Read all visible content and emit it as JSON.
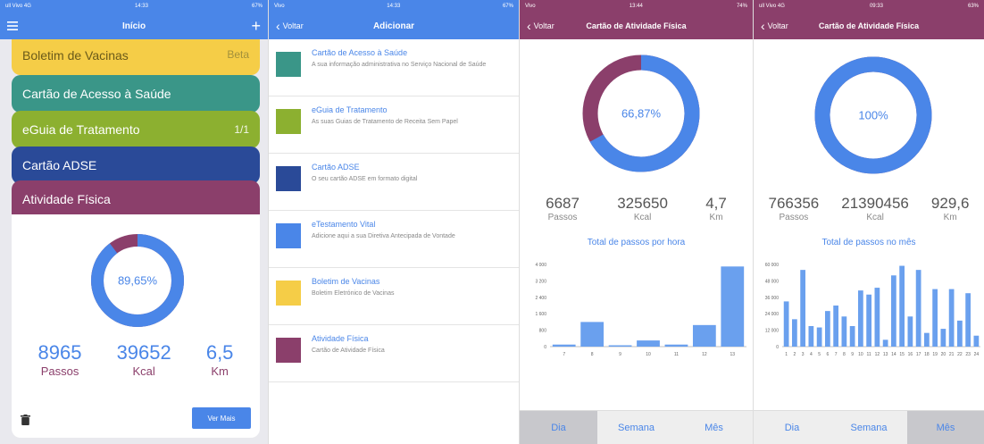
{
  "colors": {
    "blue": "#4a86e8",
    "purple": "#8b3f6b",
    "yellow": "#f5cd47",
    "teal": "#3a9688",
    "olive": "#8cb030",
    "navy": "#2a4a98"
  },
  "screen1": {
    "status": {
      "left": "ull Vivo 4G",
      "center": "14:33",
      "right": "67%"
    },
    "nav": {
      "title": "Início",
      "add": "+"
    },
    "cards": [
      {
        "label": "Boletim de Vacinas",
        "count": "Beta"
      },
      {
        "label": "Cartão de Acesso à Saúde",
        "count": ""
      },
      {
        "label": "eGuia de Tratamento",
        "count": "1/1"
      },
      {
        "label": "Cartão ADSE",
        "count": ""
      },
      {
        "label": "Atividade Física",
        "count": ""
      }
    ],
    "ring": {
      "label": "89,65%",
      "fraction": 0.8965
    },
    "stats": [
      {
        "value": "8965",
        "label": "Passos"
      },
      {
        "value": "39652",
        "label": "Kcal"
      },
      {
        "value": "6,5",
        "label": "Km"
      }
    ],
    "more_button": "Ver Mais"
  },
  "screen2": {
    "status": {
      "left": "Vivo",
      "center": "14:33",
      "right": "67%"
    },
    "nav": {
      "back": "Voltar",
      "title": "Adicionar"
    },
    "items": [
      {
        "title": "Cartão de Acesso à Saúde",
        "subtitle": "A sua informação administrativa no Serviço Nacional de Saúde",
        "color": "#3a9688"
      },
      {
        "title": "eGuia de Tratamento",
        "subtitle": "As suas Guias de Tratamento de Receita Sem Papel",
        "color": "#8cb030"
      },
      {
        "title": "Cartão ADSE",
        "subtitle": "O seu cartão ADSE em formato digital",
        "color": "#2a4a98"
      },
      {
        "title": "eTestamento Vital",
        "subtitle": "Adicione aqui a sua Diretiva Antecipada de Vontade",
        "color": "#4a86e8"
      },
      {
        "title": "Boletim de Vacinas",
        "subtitle": "Boletim Eletrónico de Vacinas",
        "color": "#f5cd47"
      },
      {
        "title": "Atividade Física",
        "subtitle": "Cartão de Atividade Física",
        "color": "#8b3f6b"
      }
    ]
  },
  "screen3": {
    "status": {
      "left": "Vivo",
      "center": "13:44",
      "right": "74%"
    },
    "nav": {
      "back": "Voltar",
      "title": "Cartão de Atividade Física"
    },
    "ring": {
      "label": "66,87%",
      "fraction": 0.6687
    },
    "stats": [
      {
        "value": "6687",
        "label": "Passos"
      },
      {
        "value": "325650",
        "label": "Kcal"
      },
      {
        "value": "4,7",
        "label": "Km"
      }
    ],
    "chart_title": "Total de passos por hora",
    "tabs": [
      "Dia",
      "Semana",
      "Mês"
    ],
    "active_tab": 0,
    "chart_data": {
      "type": "bar",
      "title": "Total de passos por hora",
      "categories": [
        "7",
        "8",
        "9",
        "10",
        "11",
        "12",
        "13"
      ],
      "values": [
        100,
        1200,
        50,
        300,
        100,
        1050,
        3900
      ],
      "ylim": [
        0,
        4000
      ],
      "yticks": [
        "0",
        "800",
        "1 600",
        "2 400",
        "3 200",
        "4 000"
      ]
    }
  },
  "screen4": {
    "status": {
      "left": "ull Vivo 4G",
      "center": "09:33",
      "right": "63%"
    },
    "nav": {
      "back": "Voltar",
      "title": "Cartão de Atividade Física"
    },
    "ring": {
      "label": "100%",
      "fraction": 1.0
    },
    "stats": [
      {
        "value": "766356",
        "label": "Passos"
      },
      {
        "value": "21390456",
        "label": "Kcal"
      },
      {
        "value": "929,6",
        "label": "Km"
      }
    ],
    "chart_title": "Total de passos no mês",
    "tabs": [
      "Dia",
      "Semana",
      "Mês"
    ],
    "active_tab": 2,
    "chart_data": {
      "type": "bar",
      "title": "Total de passos no mês",
      "categories": [
        "1",
        "2",
        "3",
        "4",
        "5",
        "6",
        "7",
        "8",
        "9",
        "10",
        "11",
        "12",
        "13",
        "14",
        "15",
        "16",
        "17",
        "18",
        "19",
        "20",
        "21",
        "22",
        "23",
        "24"
      ],
      "values": [
        33000,
        20000,
        56000,
        15000,
        14000,
        26000,
        30000,
        22000,
        15000,
        41000,
        38000,
        43000,
        5000,
        52000,
        59000,
        22000,
        56000,
        10000,
        42000,
        13000,
        42000,
        19000,
        39000,
        8000
      ],
      "ylim": [
        0,
        60000
      ],
      "yticks": [
        "0",
        "12 000",
        "24 000",
        "36 000",
        "48 000",
        "60 000"
      ]
    }
  }
}
